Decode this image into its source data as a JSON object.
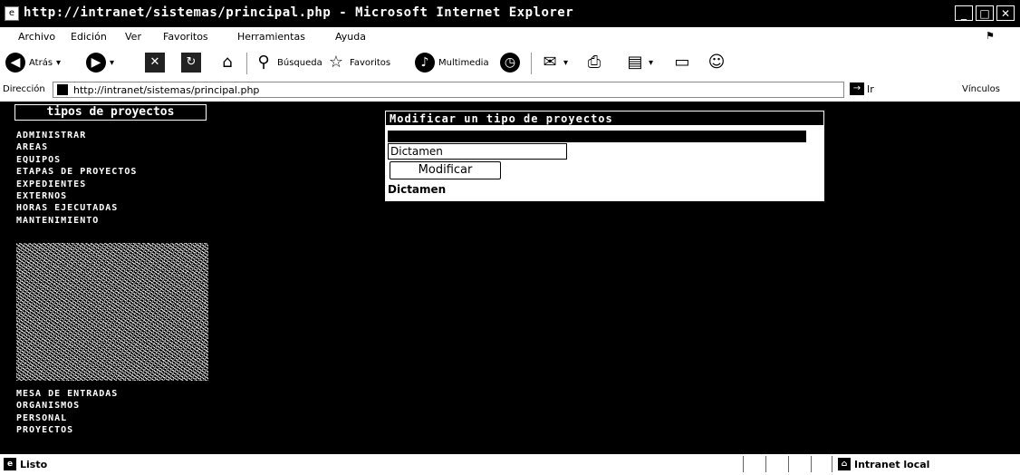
{
  "window": {
    "title": "http://intranet/sistemas/principal.php - Microsoft Internet Explorer",
    "controls": [
      "_",
      "□",
      "✕"
    ]
  },
  "menu": {
    "items": [
      "Archivo",
      "Edición",
      "Ver",
      "Favoritos",
      "Herramientas",
      "Ayuda"
    ]
  },
  "toolbar": {
    "back": "Atrás",
    "search": "Búsqueda",
    "favorites": "Favoritos",
    "multimedia": "Multimedia"
  },
  "address": {
    "label": "Dirección",
    "url": "http://intranet/sistemas/principal.php",
    "go": "Ir",
    "links": "Vínculos"
  },
  "sidebar": {
    "title": "tipos de proyectos",
    "menu_top": [
      "ADMINISTRAR",
      "AREAS",
      "EQUIPOS",
      "ETAPAS DE PROYECTOS",
      "EXPEDIENTES",
      "EXTERNOS",
      "HORAS EJECUTADAS",
      "MANTENIMIENTO"
    ],
    "menu_bottom": [
      "MESA DE ENTRADAS",
      "ORGANISMOS",
      "PERSONAL",
      "PROYECTOS"
    ]
  },
  "form": {
    "header": "Modificar un tipo de proyectos",
    "input_value": "Dictamen",
    "button": "Modificar",
    "result": "Dictamen"
  },
  "status": {
    "text": "Listo",
    "zone": "Intranet local"
  }
}
